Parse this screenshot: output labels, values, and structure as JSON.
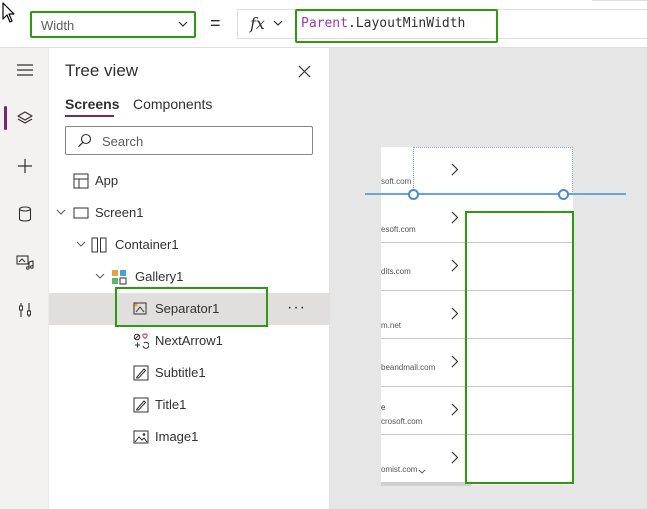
{
  "formula_bar": {
    "property_value": "Width",
    "equals": "=",
    "fx_label": "fx",
    "formula": {
      "keyword": "Parent",
      "dot": ".",
      "property": "LayoutMinWidth"
    }
  },
  "rail": {
    "items": [
      {
        "name": "menu-icon",
        "active": false
      },
      {
        "name": "layers-icon",
        "active": true
      },
      {
        "name": "add-icon",
        "active": false
      },
      {
        "name": "data-icon",
        "active": false
      },
      {
        "name": "media-icon",
        "active": false
      },
      {
        "name": "tools-icon",
        "active": false
      }
    ]
  },
  "tree_view": {
    "title": "Tree view",
    "tabs": {
      "screens": "Screens",
      "components": "Components"
    },
    "search_placeholder": "Search",
    "nodes": {
      "app": "App",
      "screen1": "Screen1",
      "container1": "Container1",
      "gallery1": "Gallery1",
      "separator1": "Separator1",
      "nextarrow1": "NextArrow1",
      "subtitle1": "Subtitle1",
      "title1": "Title1",
      "image1": "Image1"
    },
    "more_label": "···"
  },
  "canvas": {
    "gallery_rows": [
      {
        "line2": "",
        "email": "soft.com"
      },
      {
        "line2": "",
        "email": "esoft.com"
      },
      {
        "line2": "",
        "email": "dits.com"
      },
      {
        "line2": "",
        "email": "m.net"
      },
      {
        "line2": "",
        "email": "beandmail.com"
      },
      {
        "line2": "e",
        "email": "crosoft.com"
      },
      {
        "line2": "",
        "email": "omist.com"
      }
    ]
  },
  "colors": {
    "accent_purple": "#742774",
    "highlight_green": "#2e9a12",
    "selection_blue": "#4a8ad4",
    "canvas_bg": "#e6e6e6"
  }
}
